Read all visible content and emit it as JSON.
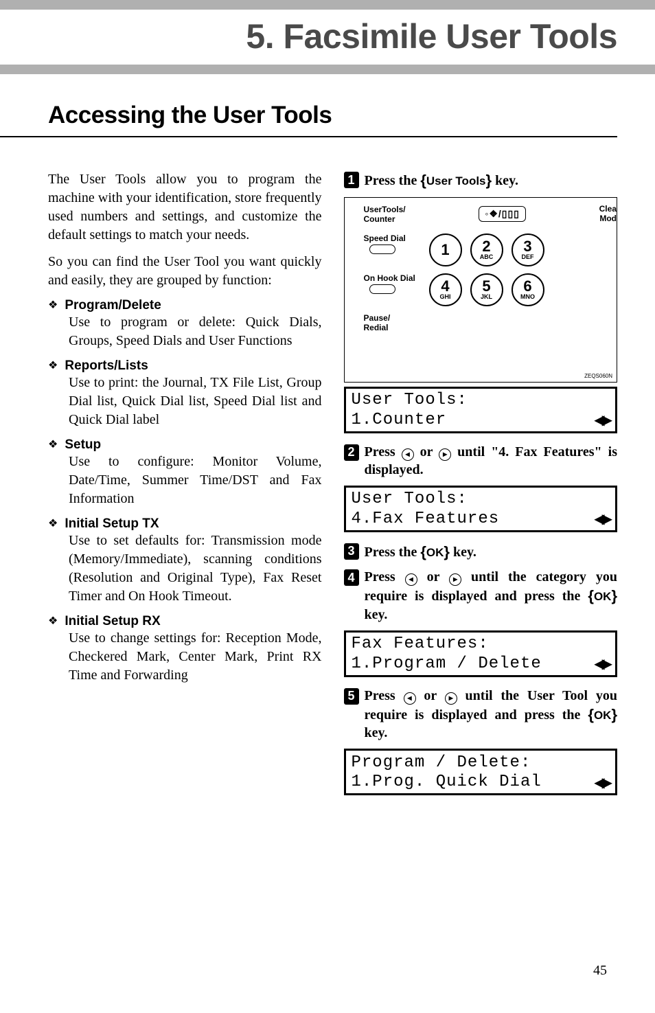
{
  "chapter_title": "5. Facsimile User Tools",
  "section_title": "Accessing the User Tools",
  "intro_para1": "The User Tools allow you to program the machine with your identification, store frequently used numbers and settings, and customize the default settings to match your needs.",
  "intro_para2": "So you can find the User Tool you want quickly and easily, they are grouped by function:",
  "items": [
    {
      "label": "Program/Delete",
      "desc": "Use to program or delete: Quick Dials, Groups, Speed Dials and User Functions"
    },
    {
      "label": "Reports/Lists",
      "desc": "Use to print: the Journal, TX File List, Group Dial list, Quick Dial list, Speed Dial list and Quick Dial label"
    },
    {
      "label": "Setup",
      "desc": "Use to configure: Monitor Volume, Date/Time, Summer Time/DST and Fax Information"
    },
    {
      "label": "Initial Setup TX",
      "desc": "Use to set defaults for: Transmission mode (Memory/Immediate), scanning conditions (Resolution and Original Type), Fax Reset Timer and On Hook Timeout."
    },
    {
      "label": "Initial Setup RX",
      "desc": "Use to change settings for: Reception Mode, Checkered Mark, Center Mark, Print RX Time and Forwarding"
    }
  ],
  "panel": {
    "user_tools_label": "UserTools/",
    "counter_label": "Counter",
    "badge": "◦❖/▯▯▯",
    "clear_label": "Clea",
    "mode_label": "Mod",
    "speed_dial": "Speed Dial",
    "on_hook": "On Hook Dial",
    "pause": "Pause/",
    "redial": "Redial",
    "keys": [
      {
        "big": "1",
        "small": ""
      },
      {
        "big": "2",
        "small": "ABC"
      },
      {
        "big": "3",
        "small": "DEF"
      },
      {
        "big": "4",
        "small": "GHI"
      },
      {
        "big": "5",
        "small": "JKL"
      },
      {
        "big": "6",
        "small": "MNO"
      }
    ],
    "fignum": "ZEQS060N"
  },
  "lcd1": {
    "line1": "User Tools:",
    "line2": "1.Counter"
  },
  "lcd2": {
    "line1": "User Tools:",
    "line2": "4.Fax Features"
  },
  "lcd3": {
    "line1": "Fax Features:",
    "line2": "1.Program / Delete"
  },
  "lcd4": {
    "line1": "Program / Delete:",
    "line2": "1.Prog. Quick Dial"
  },
  "steps": {
    "s1_pre": "Press the ",
    "s1_key": "User Tools",
    "s1_post": " key.",
    "s2": "Press ⊙ or ⊙ until \"4. Fax Features\" is displayed.",
    "s2_pre": "Press ",
    "s2_mid": " or ",
    "s2_post": " until \"4. Fax Features\" is displayed.",
    "s3_pre": "Press the ",
    "s3_key": "OK",
    "s3_post": " key.",
    "s4_pre": "Press ",
    "s4_mid": " or ",
    "s4_mid2": " until the category you require is displayed and press the ",
    "s4_key": "OK",
    "s4_post": " key.",
    "s5_pre": "Press ",
    "s5_mid": " or ",
    "s5_mid2": " until the User Tool you require is displayed and press the ",
    "s5_key": "OK",
    "s5_post": " key."
  },
  "page_number": "45"
}
